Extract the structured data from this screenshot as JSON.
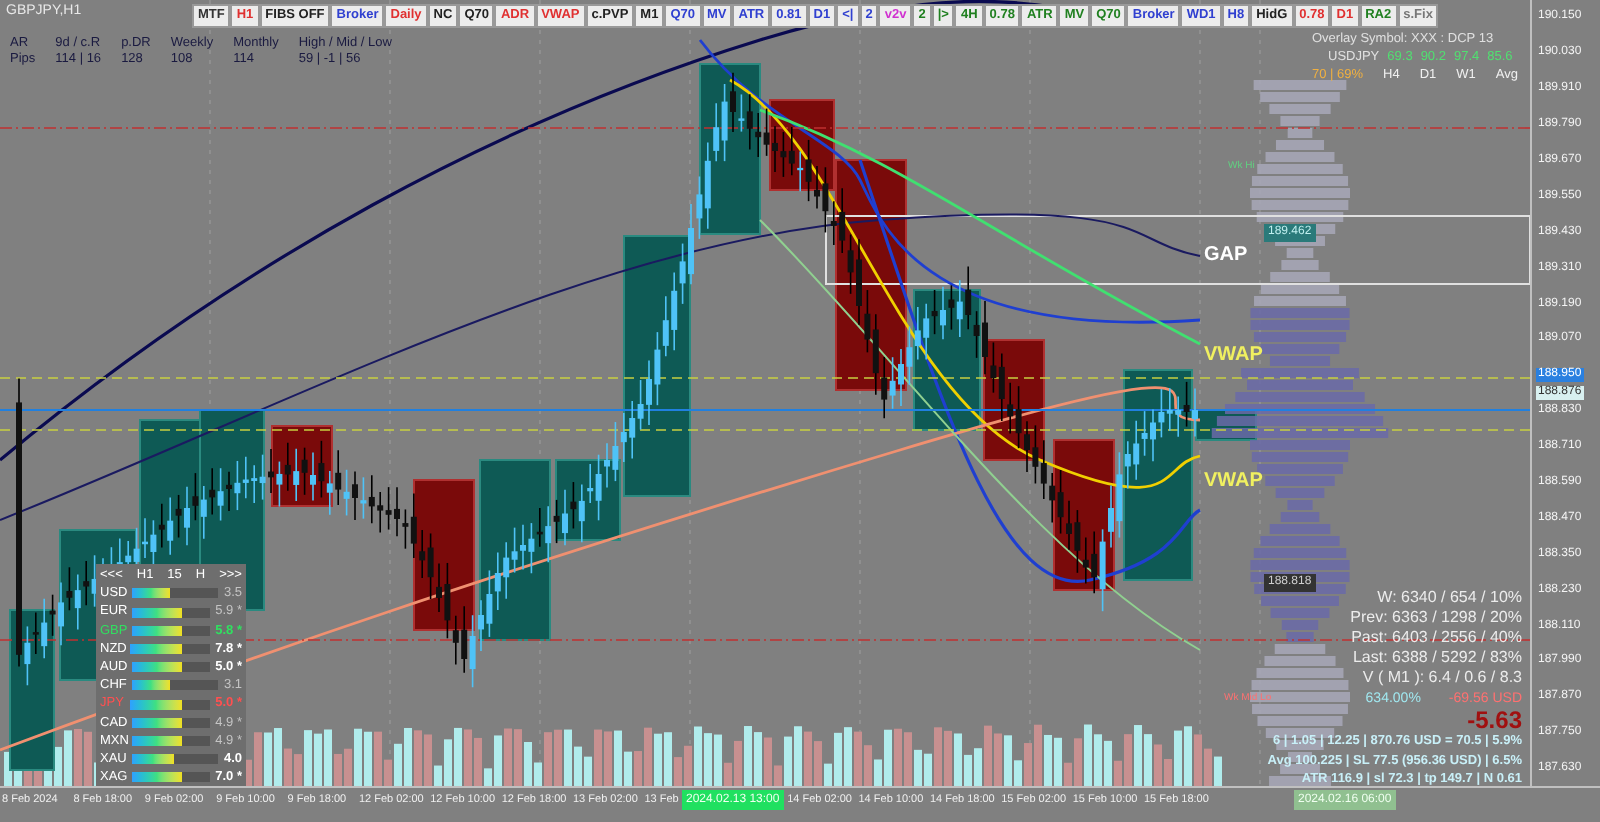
{
  "chart_title": "GBPJPY,H1",
  "toolbar": [
    {
      "label": "MTF",
      "color": "#333333"
    },
    {
      "label": "H1",
      "color": "#e03030"
    },
    {
      "label": "FIBS OFF",
      "color": "#222222"
    },
    {
      "label": "Broker",
      "color": "#3040d0"
    },
    {
      "label": "Daily",
      "color": "#e03030"
    },
    {
      "label": "NC",
      "color": "#222222"
    },
    {
      "label": "Q70",
      "color": "#222222"
    },
    {
      "label": "ADR",
      "color": "#e03030"
    },
    {
      "label": "VWAP",
      "color": "#e03030"
    },
    {
      "label": "c.PVP",
      "color": "#222222"
    },
    {
      "label": "M1",
      "color": "#222222"
    },
    {
      "label": "Q70",
      "color": "#3040d0"
    },
    {
      "label": "MV",
      "color": "#3040d0"
    },
    {
      "label": "ATR",
      "color": "#3040d0"
    },
    {
      "label": "0.81",
      "color": "#3040d0"
    },
    {
      "label": "D1",
      "color": "#3040d0"
    },
    {
      "label": "<|",
      "color": "#3040d0"
    },
    {
      "label": "2",
      "color": "#3040d0"
    },
    {
      "label": "v2v",
      "color": "#d030d0"
    },
    {
      "label": "2",
      "color": "#208020"
    },
    {
      "label": "|>",
      "color": "#208020"
    },
    {
      "label": "4H",
      "color": "#208020"
    },
    {
      "label": "0.78",
      "color": "#208020"
    },
    {
      "label": "ATR",
      "color": "#208020"
    },
    {
      "label": "MV",
      "color": "#208020"
    },
    {
      "label": "Q70",
      "color": "#208020"
    },
    {
      "label": "Broker",
      "color": "#3040d0"
    },
    {
      "label": "WD1",
      "color": "#3040d0"
    },
    {
      "label": "H8",
      "color": "#3040d0"
    },
    {
      "label": "HidG",
      "color": "#222222"
    },
    {
      "label": "0.78",
      "color": "#e03030"
    },
    {
      "label": "D1",
      "color": "#e03030"
    },
    {
      "label": "RA2",
      "color": "#208020"
    },
    {
      "label": "s.Fix",
      "color": "#777777"
    }
  ],
  "range_info": [
    {
      "heading": "AR",
      "value": "Pips"
    },
    {
      "heading": "9d / c.R",
      "value": "114 | 16"
    },
    {
      "heading": "p.DR",
      "value": "128"
    },
    {
      "heading": "Weekly",
      "value": "108"
    },
    {
      "heading": "Monthly",
      "value": "114"
    },
    {
      "heading": "High / Mid / Low",
      "value": "59  |  -1  |  56"
    }
  ],
  "overlay": {
    "title": "Overlay Symbol: XXX : DCP 13",
    "symbol": "USDJPY",
    "values": [
      "69.3",
      "90.2",
      "97.4",
      "85.6"
    ],
    "score": "70 | 69%",
    "periods": [
      "H4",
      "D1",
      "W1",
      "Avg"
    ]
  },
  "chart_labels": {
    "gap": "GAP",
    "vwap_upper": "VWAP",
    "vwap_lower": "VWAP",
    "week_high": "Wk Hi",
    "week_mid_low": "Wk Mid Lo",
    "gap_price": "189.462",
    "profile_price": "188.818"
  },
  "strength_panel": {
    "header": [
      "<<<",
      "H1",
      "15",
      "H",
      ">>>"
    ],
    "rows": [
      {
        "currency": "USD",
        "color": "#ffffff",
        "level": 0.45,
        "value": "3.5",
        "dimmed": true,
        "starred": false
      },
      {
        "currency": "EUR",
        "color": "#ffffff",
        "level": 0.65,
        "value": "5.9",
        "dimmed": true,
        "starred": true
      },
      {
        "currency": "GBP",
        "color": "#30e060",
        "level": 0.65,
        "value": "5.8",
        "dimmed": false,
        "starred": true
      },
      {
        "currency": "NZD",
        "color": "#ffffff",
        "level": 0.65,
        "value": "7.8",
        "dimmed": false,
        "starred": true
      },
      {
        "currency": "AUD",
        "color": "#ffffff",
        "level": 0.65,
        "value": "5.0",
        "dimmed": false,
        "starred": true
      },
      {
        "currency": "CHF",
        "color": "#ffffff",
        "level": 0.45,
        "value": "3.1",
        "dimmed": true,
        "starred": false
      },
      {
        "currency": "JPY",
        "color": "#ff5050",
        "level": 0.65,
        "value": "5.0",
        "dimmed": false,
        "starred": true
      },
      {
        "currency": "CAD",
        "color": "#ffffff",
        "level": 0.65,
        "value": "4.9",
        "dimmed": true,
        "starred": true
      },
      {
        "currency": "MXN",
        "color": "#ffffff",
        "level": 0.65,
        "value": "4.9",
        "dimmed": true,
        "starred": true
      },
      {
        "currency": "XAU",
        "color": "#ffffff",
        "level": 0.5,
        "value": "4.0",
        "dimmed": false,
        "starred": false
      },
      {
        "currency": "XAG",
        "color": "#ffffff",
        "level": 0.65,
        "value": "7.0",
        "dimmed": false,
        "starred": true
      }
    ],
    "star": "*"
  },
  "stats": {
    "lines": [
      "W: 6340 / 654 / 10%",
      "Prev: 6363 / 1298 / 20%",
      "Past: 6403 / 2556 / 40%",
      "Last: 6388 / 5292 / 83%",
      "V ( M1 ): 6.4 / 0.6 / 8.3"
    ],
    "percent": "634.00%",
    "pnl": "-69.56 USD",
    "pnl_pips": "-5.63",
    "risk_lines": [
      "6  |  1.05  |  12.25  |  870.76 USD = 70.5  |  5.9%",
      "Avg 100.225  |  SL 77.5 (956.36 USD)  |  6.5%",
      "ATR 116.9  |  sl 72.3  |  tp 149.7  |  N 0.61"
    ]
  },
  "price_axis": {
    "ticks": [
      {
        "label": "190.150",
        "highlighted": false
      },
      {
        "label": "190.030",
        "highlighted": false
      },
      {
        "label": "189.910",
        "highlighted": false
      },
      {
        "label": "189.790",
        "highlighted": false
      },
      {
        "label": "189.670",
        "highlighted": false
      },
      {
        "label": "189.550",
        "highlighted": false
      },
      {
        "label": "189.430",
        "highlighted": false
      },
      {
        "label": "189.310",
        "highlighted": false
      },
      {
        "label": "189.190",
        "highlighted": false
      },
      {
        "label": "189.070",
        "highlighted": false
      },
      {
        "label": "188.950",
        "highlighted": true
      },
      {
        "label": "188.830",
        "highlighted": false
      },
      {
        "label": "188.710",
        "highlighted": false
      },
      {
        "label": "188.590",
        "highlighted": false
      },
      {
        "label": "188.470",
        "highlighted": false
      },
      {
        "label": "188.350",
        "highlighted": false
      },
      {
        "label": "188.230",
        "highlighted": false
      },
      {
        "label": "188.110",
        "highlighted": false
      },
      {
        "label": "187.990",
        "highlighted": false
      },
      {
        "label": "187.870",
        "highlighted": false
      },
      {
        "label": "187.750",
        "highlighted": false
      },
      {
        "label": "187.630",
        "highlighted": false
      }
    ],
    "current_price": "188.876"
  },
  "time_axis": {
    "labels_before_cursor": [
      "8 Feb 2024",
      "8 Feb 18:00",
      "9 Feb 02:00",
      "9 Feb 10:00",
      "9 Feb 18:00",
      "12 Feb 02:00",
      "12 Feb 10:00",
      "12 Feb 18:00",
      "13 Feb 02:00",
      "13 Feb"
    ],
    "labels_after_cursor": [
      "14 Feb 02:00",
      "14 Feb 10:00",
      "14 Feb 18:00",
      "15 Feb 02:00",
      "15 Feb 10:00",
      "15 Feb 18:00"
    ],
    "cursor_time": "2024.02.13 13:00",
    "end_time": "2024.02.16 06:00"
  }
}
